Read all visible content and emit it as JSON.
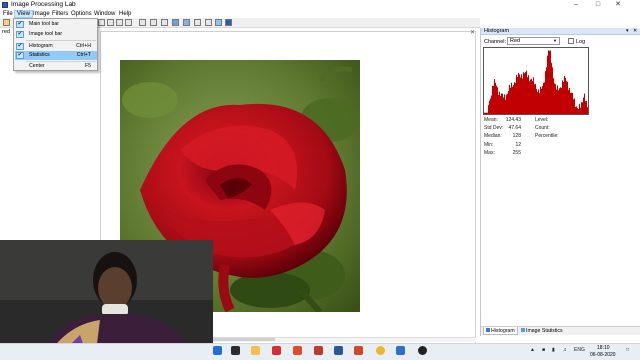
{
  "window": {
    "title": "Image Processing Lab",
    "minimize": "–",
    "maximize": "□",
    "close": "✕"
  },
  "menu": {
    "items": [
      "File",
      "View",
      "Image",
      "Filters",
      "Options",
      "Window",
      "Help"
    ]
  },
  "document": {
    "tab_label": "red",
    "close_glyph": "✕",
    "pin_glyph": "▾"
  },
  "view_menu": {
    "items": [
      {
        "label": "Main tool bar",
        "shortcut": "",
        "checked": true
      },
      {
        "label": "Image tool bar",
        "shortcut": "",
        "checked": true
      },
      {
        "label": "Histogram",
        "shortcut": "Ctrl+H",
        "checked": true
      },
      {
        "label": "Statistics",
        "shortcut": "Ctrl+T",
        "checked": true,
        "highlighted": true
      },
      {
        "label": "Center",
        "shortcut": "F5",
        "checked": false
      }
    ],
    "check_glyph": "✔"
  },
  "histogram_panel": {
    "title": "Histogram",
    "pin_glyph": "▾",
    "close_glyph": "✕",
    "channel_label": "Channel:",
    "channel_value": "Red",
    "dropdown_glyph": "▼",
    "log_label": "Log",
    "bar_color": "#c00000",
    "stats_left": [
      {
        "label": "Mean:",
        "value": "124.43"
      },
      {
        "label": "Std Dev:",
        "value": "47.64"
      },
      {
        "label": "Median:",
        "value": "128"
      },
      {
        "label": "Min:",
        "value": "12"
      },
      {
        "label": "Max:",
        "value": "255"
      }
    ],
    "stats_right": [
      {
        "label": "Level:"
      },
      {
        "label": "Count:"
      },
      {
        "label": "Percentile:"
      }
    ],
    "tabs": [
      "Histogram",
      "Image Statistics"
    ]
  },
  "taskbar": {
    "tray_lang": "ENG",
    "time": "18:10",
    "date": "06-08-2020"
  }
}
